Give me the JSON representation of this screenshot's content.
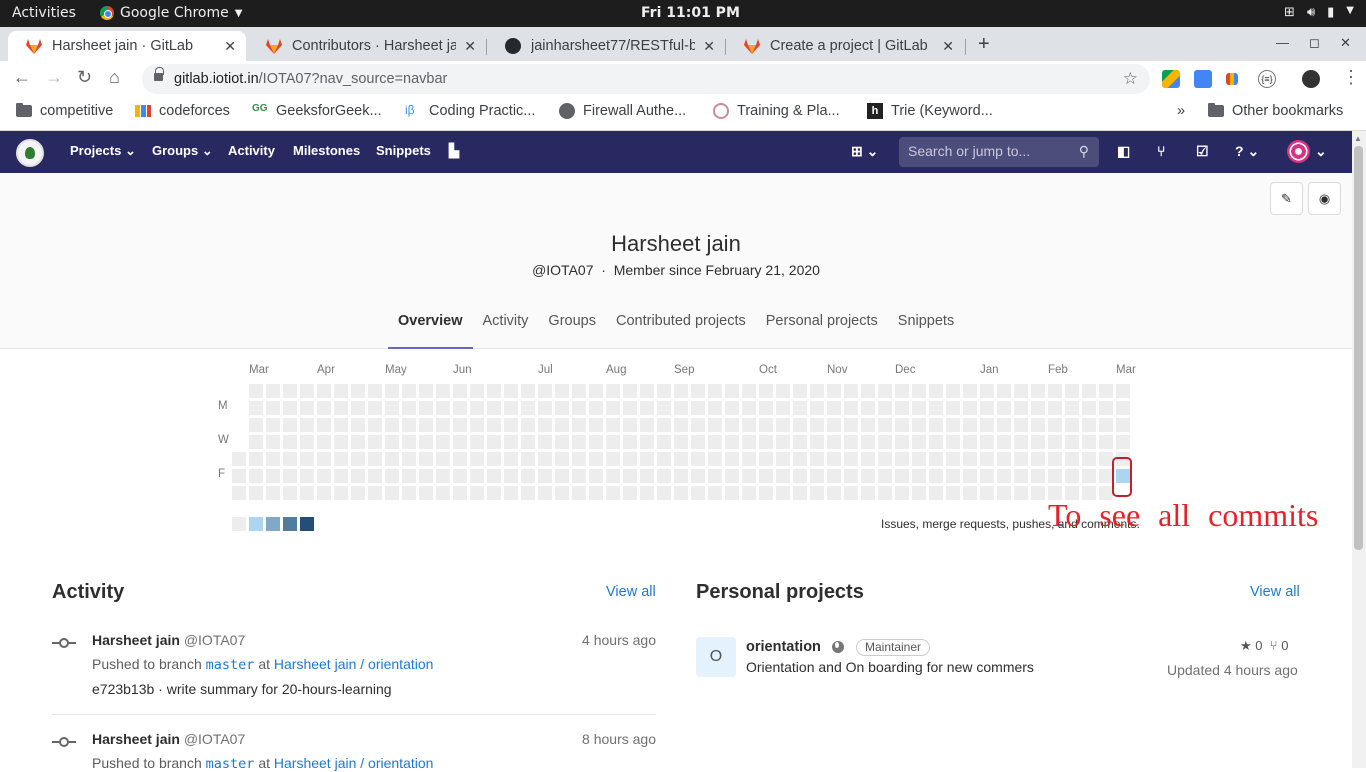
{
  "os_bar": {
    "activities": "Activities",
    "app_name": "Google Chrome",
    "clock": "Fri 11:01 PM"
  },
  "tabs": [
    {
      "title": "Harsheet jain · GitLab",
      "active": true
    },
    {
      "title": "Contributors · Harsheet ja",
      "active": false
    },
    {
      "title": "jainharsheet77/RESTful-b",
      "active": false
    },
    {
      "title": "Create a project | GitLab",
      "active": false
    }
  ],
  "address_bar": {
    "host": "gitlab.iotiot.in",
    "path": "/IOTA07?nav_source=navbar"
  },
  "bookmarks": [
    {
      "label": "competitive",
      "icon": "folder-icon"
    },
    {
      "label": "codeforces",
      "icon": "bar-chart-icon"
    },
    {
      "label": "GeeksforGeek...",
      "icon": "gfg-icon"
    },
    {
      "label": "Coding Practic...",
      "icon": "ib-icon"
    },
    {
      "label": "Firewall Authe...",
      "icon": "globe-icon"
    },
    {
      "label": "Training & Pla...",
      "icon": "seal-icon"
    },
    {
      "label": "Trie (Keyword...",
      "icon": "h-icon"
    }
  ],
  "bookmarks_overflow": "»",
  "other_bookmarks": "Other bookmarks",
  "gitlab_nav": {
    "projects": "Projects",
    "groups": "Groups",
    "activity": "Activity",
    "milestones": "Milestones",
    "snippets": "Snippets",
    "search_placeholder": "Search or jump to..."
  },
  "profile": {
    "name": "Harsheet jain",
    "username": "@IOTA07",
    "separator": "·",
    "member_since": "Member since February 21, 2020"
  },
  "profile_tabs": [
    "Overview",
    "Activity",
    "Groups",
    "Contributed projects",
    "Personal projects",
    "Snippets"
  ],
  "calendar": {
    "months": [
      "Mar",
      "Apr",
      "May",
      "Jun",
      "Jul",
      "Aug",
      "Sep",
      "Oct",
      "Nov",
      "Dec",
      "Jan",
      "Feb",
      "Mar"
    ],
    "weekday_labels": [
      "M",
      "W",
      "F"
    ],
    "weeks": 52,
    "active_cell": {
      "week": 52,
      "day": 5,
      "level": 1
    },
    "legend_colors": [
      "#ededed",
      "#acd5f2",
      "#7fa8c9",
      "#527ba0",
      "#254e77"
    ],
    "caption": "Issues, merge requests, pushes, and comments."
  },
  "annotation": "To see all commits",
  "activity_section": {
    "title": "Activity",
    "view_all": "View all",
    "events": [
      {
        "author": "Harsheet jain",
        "handle": "@IOTA07",
        "time": "4 hours ago",
        "action": "Pushed to branch",
        "branch": "master",
        "at": "at",
        "project": "Harsheet jain / orientation",
        "commit": "e723b13b · write summary for 20-hours-learning"
      },
      {
        "author": "Harsheet jain",
        "handle": "@IOTA07",
        "time": "8 hours ago",
        "action": "Pushed to branch",
        "branch": "master",
        "at": "at",
        "project": "Harsheet jain / orientation"
      }
    ]
  },
  "projects_section": {
    "title": "Personal projects",
    "view_all": "View all",
    "project": {
      "avatar_letter": "O",
      "name": "orientation",
      "role": "Maintainer",
      "description": "Orientation and On boarding for new commers",
      "stars": "0",
      "forks": "0",
      "updated": "Updated 4 hours ago"
    }
  }
}
